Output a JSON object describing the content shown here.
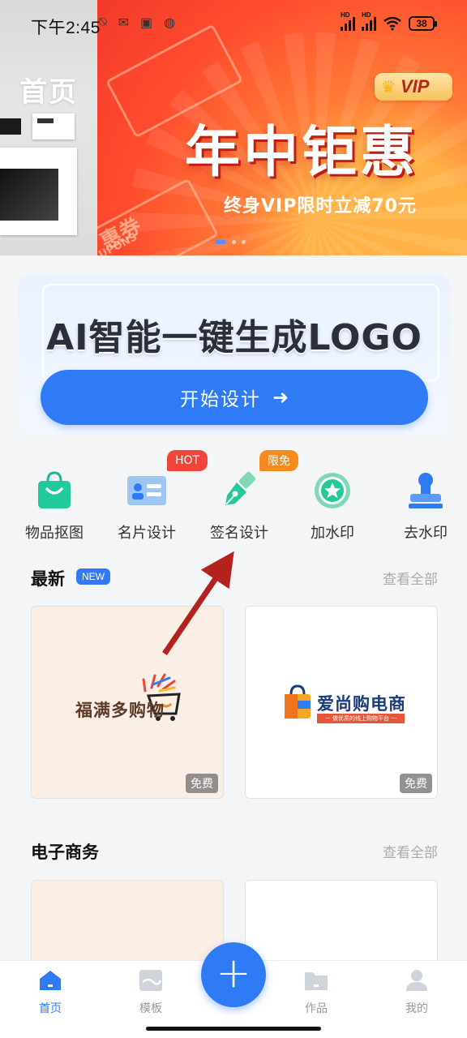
{
  "status_bar": {
    "time": "下午2:45",
    "battery": "38"
  },
  "header": {
    "title": "首页"
  },
  "banner": {
    "vip_label": "VIP",
    "headline": "年中钜惠",
    "subline": "终身VIP限时立减70元",
    "coupon_text": "惠券",
    "coupon_text_en": "UPONS",
    "slide_count": 3,
    "active_slide": 1
  },
  "ai_card": {
    "title": "AI智能一键生成LOGO",
    "button_label": "开始设计"
  },
  "tools": [
    {
      "label": "物品抠图",
      "icon": "shopping-bag-icon"
    },
    {
      "label": "名片设计",
      "icon": "business-card-icon"
    },
    {
      "label": "签名设计",
      "icon": "pen-nib-icon",
      "tag": "HOT"
    },
    {
      "label": "加水印",
      "icon": "star-badge-icon",
      "tag": "限免"
    },
    {
      "label": "去水印",
      "icon": "stamp-icon"
    }
  ],
  "sections": {
    "latest": {
      "title": "最新",
      "badge": "NEW",
      "see_all": "查看全部",
      "cards": [
        {
          "logo_text": "福满多购物",
          "free_label": "免费"
        },
        {
          "logo_text": "爱尚购电商",
          "logo_sub": "一 做优质的线上购物平台 一",
          "free_label": "免费"
        }
      ]
    },
    "ecommerce": {
      "title": "电子商务",
      "see_all": "查看全部"
    }
  },
  "bottom_nav": [
    {
      "label": "首页",
      "icon": "home-icon",
      "active": true
    },
    {
      "label": "模板",
      "icon": "template-icon"
    },
    {
      "label": "作品",
      "icon": "folder-icon"
    },
    {
      "label": "我的",
      "icon": "user-icon"
    }
  ],
  "colors": {
    "primary": "#2f7bf5",
    "banner_red": "#f33a2a",
    "hot_tag": "#f1443a",
    "free_tag": "#f58a1f"
  }
}
